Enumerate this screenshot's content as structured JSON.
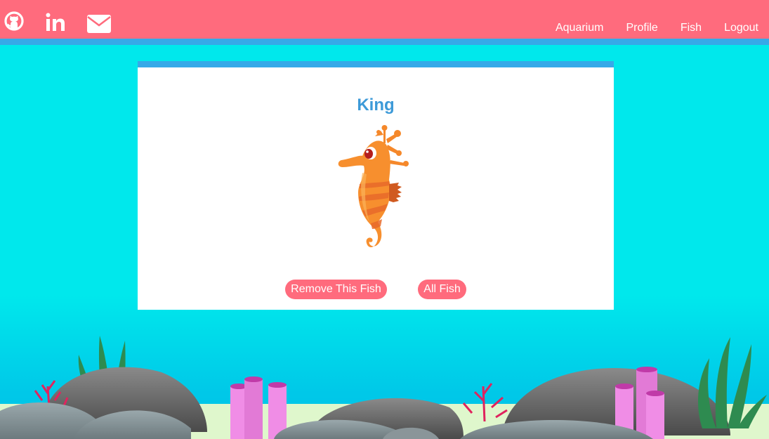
{
  "nav": {
    "social": [
      {
        "icon": "github-icon"
      },
      {
        "icon": "linkedin-icon"
      },
      {
        "icon": "envelope-icon"
      }
    ],
    "links": [
      {
        "label": "Aquarium"
      },
      {
        "label": "Profile"
      },
      {
        "label": "Fish"
      },
      {
        "label": "Logout"
      }
    ]
  },
  "fish": {
    "name": "King",
    "image": "seahorse"
  },
  "actions": {
    "remove_label": "Remove This Fish",
    "all_label": "All Fish"
  },
  "colors": {
    "navbar": "#ff6b7d",
    "stripe": "#36a9e8",
    "water": "#00e8ec",
    "title": "#3d9ad8",
    "button": "#ff6b7d"
  }
}
